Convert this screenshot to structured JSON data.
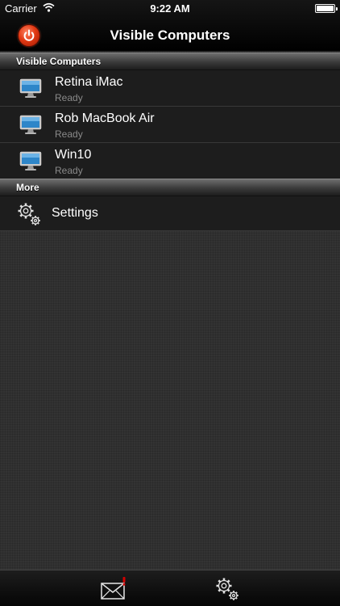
{
  "status_bar": {
    "carrier": "Carrier",
    "time": "9:22 AM"
  },
  "nav": {
    "title": "Visible Computers"
  },
  "sections": {
    "computers_header": "Visible Computers",
    "more_header": "More"
  },
  "computers": [
    {
      "name": "Retina iMac",
      "status": "Ready"
    },
    {
      "name": "Rob MacBook Air",
      "status": "Ready"
    },
    {
      "name": "Win10",
      "status": "Ready"
    }
  ],
  "more": {
    "settings_label": "Settings"
  },
  "icons": {
    "power": "power-icon",
    "computer": "monitor-icon",
    "settings": "gear-icon",
    "mail": "mail-icon"
  },
  "colors": {
    "accent": "#e23a14",
    "badge": "#d40000"
  }
}
